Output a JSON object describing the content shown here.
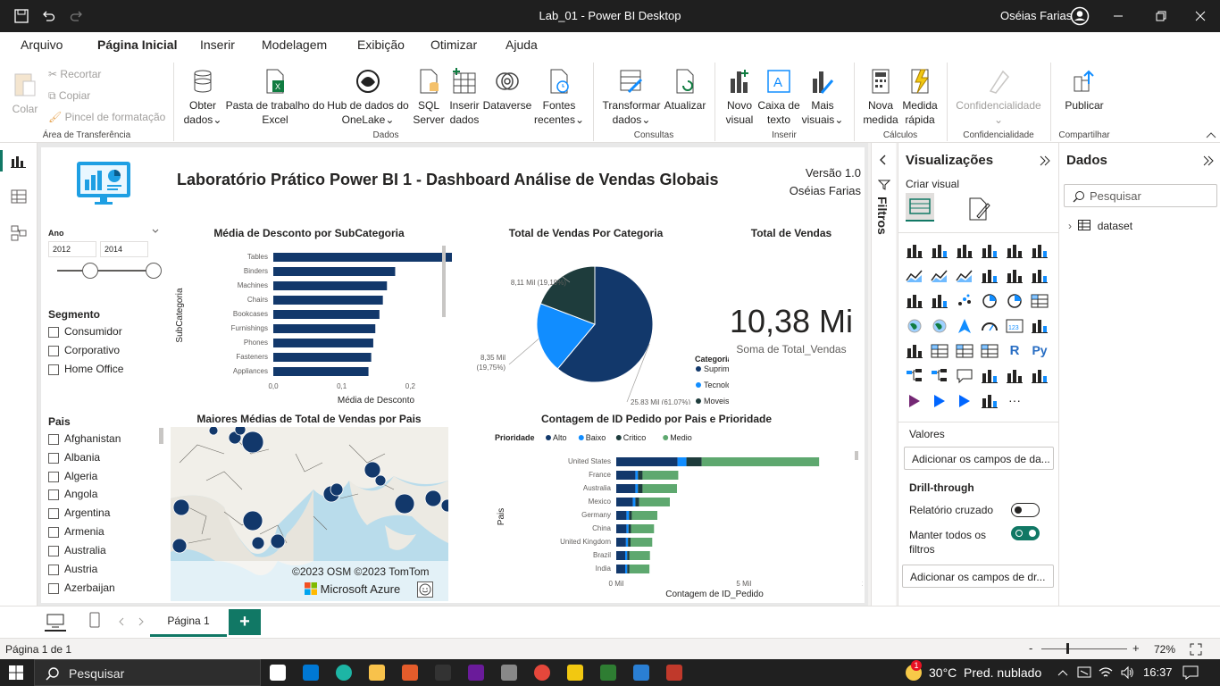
{
  "app": {
    "title": "Lab_01 - Power BI Desktop",
    "user": "Oséias Farias"
  },
  "menu": [
    "Arquivo",
    "Página Inicial",
    "Inserir",
    "Modelagem",
    "Exibição",
    "Otimizar",
    "Ajuda"
  ],
  "ribbon": {
    "clipboard": {
      "colar": "Colar",
      "recortar": "Recortar",
      "copiar": "Copiar",
      "pincel": "Pincel de formatação",
      "group": "Área de Transferência"
    },
    "dados": {
      "obter": "Obter",
      "obter2": "dados",
      "pasta": "Pasta de trabalho do",
      "pasta2": "Excel",
      "hub": "Hub de dados do",
      "hub2": "OneLake",
      "sql": "SQL",
      "sql2": "Server",
      "inserir": "Inserir",
      "inserir2": "dados",
      "dataverse": "Dataverse",
      "fontes": "Fontes",
      "fontes2": "recentes",
      "group": "Dados"
    },
    "consultas": {
      "transformar": "Transformar",
      "transformar2": "dados",
      "atualizar": "Atualizar",
      "group": "Consultas"
    },
    "inserir": {
      "novo": "Novo",
      "novo2": "visual",
      "caixa": "Caixa de",
      "caixa2": "texto",
      "mais": "Mais",
      "mais2": "visuais",
      "group": "Inserir"
    },
    "calculos": {
      "nova": "Nova",
      "nova2": "medida",
      "rapida": "Medida",
      "rapida2": "rápida",
      "group": "Cálculos"
    },
    "confid": {
      "label": "Confidencialidade",
      "group": "Confidencialidade"
    },
    "compartilhar": {
      "publicar": "Publicar",
      "group": "Compartilhar"
    }
  },
  "report": {
    "title": "Laboratório Prático Power BI 1 - Dashboard Análise de Vendas Globais",
    "version": "Versão 1.0",
    "author": "Oséias Farias",
    "ano": {
      "label": "Ano",
      "from": "2012",
      "to": "2014"
    },
    "segmento": {
      "label": "Segmento",
      "items": [
        "Consumidor",
        "Corporativo",
        "Home Office"
      ]
    },
    "pais": {
      "label": "Pais",
      "items": [
        "Afghanistan",
        "Albania",
        "Algeria",
        "Angola",
        "Argentina",
        "Armenia",
        "Australia",
        "Austria",
        "Azerbaijan"
      ]
    },
    "kpi": {
      "title": "Total de Vendas",
      "value": "10,38 Mi",
      "caption": "Soma de Total_Vendas"
    },
    "map": {
      "title": "Maiores Médias de Total de Vendas por Pais",
      "copyright": "©2023 OSM ©2023 TomTom",
      "brand": "Microsoft Azure"
    }
  },
  "chart_data": [
    {
      "type": "bar",
      "title": "Média de Desconto por SubCategoria",
      "xlabel": "Média de Desconto",
      "ylabel": "SubCategoria",
      "categories": [
        "Tables",
        "Binders",
        "Machines",
        "Chairs",
        "Bookcases",
        "Furnishings",
        "Phones",
        "Fasteners",
        "Appliances"
      ],
      "values": [
        0.29,
        0.178,
        0.166,
        0.16,
        0.155,
        0.149,
        0.146,
        0.143,
        0.139
      ],
      "xlim": [
        0,
        0.3
      ],
      "xticks": [
        "0,0",
        "0,1",
        "0,2",
        "0,3"
      ],
      "color": "#12386b"
    },
    {
      "type": "pie",
      "title": "Total de Vendas Por Categoria",
      "legend_title": "Categoria",
      "series": [
        {
          "name": "Suprimentos",
          "value": 61.07,
          "label": "25,83 Mil (61,07%)",
          "color": "#12386b"
        },
        {
          "name": "Tecnologia",
          "value": 19.75,
          "label": "8,35 Mil (19,75%)",
          "color": "#118dff"
        },
        {
          "name": "Moveis",
          "value": 19.19,
          "label": "8,11 Mil (19,19%)",
          "color": "#1e3c3c"
        }
      ]
    },
    {
      "type": "bar",
      "stacked": true,
      "title": "Contagem de ID Pedido por Pais e Prioridade",
      "xlabel": "Contagem de ID_Pedido",
      "ylabel": "Pais",
      "legend_title": "Prioridade",
      "categories": [
        "United States",
        "France",
        "Australia",
        "Mexico",
        "Germany",
        "China",
        "United Kingdom",
        "Brazil",
        "India"
      ],
      "series": [
        {
          "name": "Alto",
          "color": "#12386b",
          "values": [
            2400,
            750,
            750,
            650,
            400,
            400,
            380,
            350,
            350
          ]
        },
        {
          "name": "Baixo",
          "color": "#118dff",
          "values": [
            350,
            100,
            100,
            100,
            100,
            80,
            80,
            80,
            80
          ]
        },
        {
          "name": "Critico",
          "color": "#1e3c3c",
          "values": [
            600,
            180,
            180,
            150,
            110,
            100,
            100,
            90,
            90
          ]
        },
        {
          "name": "Medio",
          "color": "#5ea86f",
          "values": [
            4600,
            1400,
            1350,
            1200,
            1000,
            900,
            850,
            800,
            780
          ]
        }
      ],
      "xlim": [
        0,
        10500
      ],
      "xticks": [
        "0 Mil",
        "5 Mil",
        "10 Mil"
      ]
    }
  ],
  "filters_label": "Filtros",
  "viz": {
    "title": "Visualizações",
    "criar": "Criar visual",
    "valores": "Valores",
    "valores_field": "Adicionar os campos de da...",
    "drill": "Drill-through",
    "cruzado": "Relatório cruzado",
    "manter": "Manter todos os",
    "manter2": "filtros",
    "drill_field": "Adicionar os campos de dr..."
  },
  "dados": {
    "title": "Dados",
    "search": "Pesquisar",
    "table": "dataset"
  },
  "pages": {
    "tab": "Página 1"
  },
  "status": {
    "page": "Página 1 de 1",
    "zoom": "72%"
  },
  "taskbar": {
    "search": "Pesquisar",
    "weather": "30°C  Pred. nublado",
    "time": "16:37",
    "badge": "1"
  }
}
